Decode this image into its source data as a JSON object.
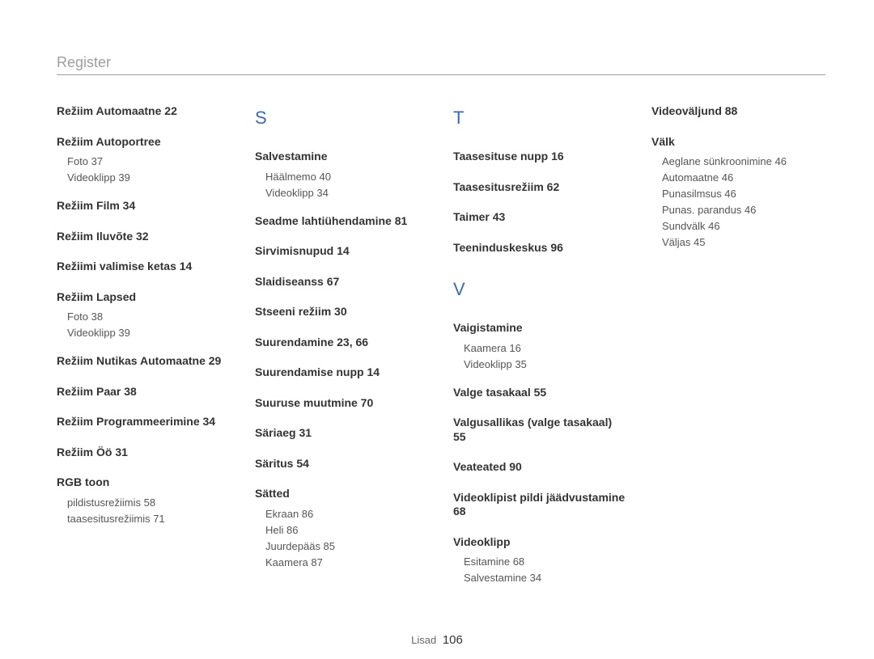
{
  "header": {
    "title": "Register"
  },
  "footer": {
    "label": "Lisad",
    "page": "106"
  },
  "col1": {
    "h1": "Režiim Automaatne  22",
    "h2": "Režiim Autoportree",
    "h2s1": "Foto  37",
    "h2s2": "Videoklipp  39",
    "h3": "Režiim Film  34",
    "h4": "Režiim Iluvõte  32",
    "h5": "Režiimi valimise ketas  14",
    "h6": "Režiim Lapsed",
    "h6s1": "Foto  38",
    "h6s2": "Videoklipp  39",
    "h7": "Režiim Nutikas Automaatne  29",
    "h8": "Režiim Paar  38",
    "h9": "Režiim Programmeerimine  34",
    "h10": "Režiim Öö  31",
    "h11": "RGB toon",
    "h11s1": "pildistusrežiimis  58",
    "h11s2": "taasesitusrežiimis  71"
  },
  "col2": {
    "letter": "S",
    "h1": "Salvestamine",
    "h1s1": "Häälmemo  40",
    "h1s2": "Videoklipp  34",
    "h2": "Seadme lahtiühendamine  81",
    "h3": "Sirvimisnupud  14",
    "h4": "Slaidiseanss  67",
    "h5": "Stseeni režiim  30",
    "h6": "Suurendamine  23, 66",
    "h7": "Suurendamise nupp  14",
    "h8": "Suuruse muutmine  70",
    "h9": "Säriaeg  31",
    "h10": "Säritus  54",
    "h11": "Sätted",
    "h11s1": "Ekraan  86",
    "h11s2": "Heli  86",
    "h11s3": "Juurdepääs  85",
    "h11s4": "Kaamera  87"
  },
  "col3": {
    "letterT": "T",
    "t1": "Taasesituse nupp  16",
    "t2": "Taasesitusrežiim  62",
    "t3": "Taimer  43",
    "t4": "Teeninduskeskus  96",
    "letterV": "V",
    "v1": "Vaigistamine",
    "v1s1": "Kaamera  16",
    "v1s2": "Videoklipp  35",
    "v2": "Valge tasakaal  55",
    "v3": "Valgusallikas (valge tasakaal)  55",
    "v4": "Veateated  90",
    "v5": "Videoklipist pildi jäädvustamine  68",
    "v6": "Videoklipp",
    "v6s1": "Esitamine  68",
    "v6s2": "Salvestamine  34"
  },
  "col4": {
    "h1": "Videoväljund  88",
    "h2": "Välk",
    "h2s1": "Aeglane sünkroonimine  46",
    "h2s2": "Automaatne  46",
    "h2s3": "Punasilmsus  46",
    "h2s4": "Punas. parandus  46",
    "h2s5": "Sundvälk  46",
    "h2s6": "Väljas  45"
  }
}
